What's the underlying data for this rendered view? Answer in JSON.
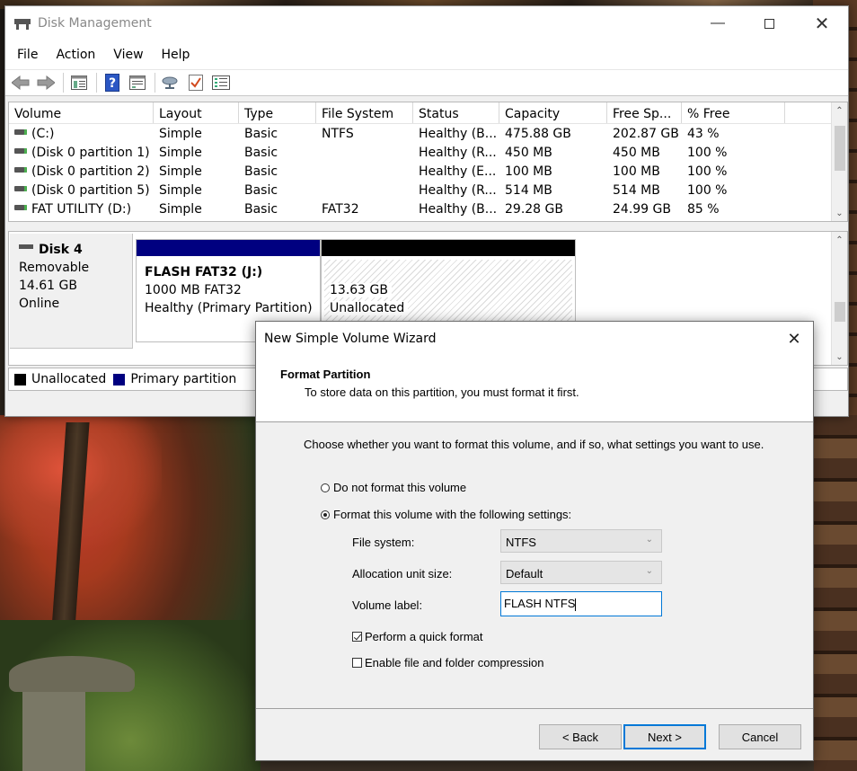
{
  "disk_management": {
    "title": "Disk Management",
    "menu": [
      "File",
      "Action",
      "View",
      "Help"
    ],
    "toolbar_icons": [
      "back-arrow-icon",
      "forward-arrow-icon",
      "console-tree-icon",
      "help-icon",
      "properties-icon",
      "connect-icon",
      "check-icon",
      "list-icon"
    ],
    "volume_table": {
      "columns": [
        "Volume",
        "Layout",
        "Type",
        "File System",
        "Status",
        "Capacity",
        "Free Sp...",
        "% Free"
      ],
      "rows": [
        [
          "(C:)",
          "Simple",
          "Basic",
          "NTFS",
          "Healthy (B...",
          "475.88 GB",
          "202.87 GB",
          "43 %"
        ],
        [
          "(Disk 0 partition 1)",
          "Simple",
          "Basic",
          "",
          "Healthy (R...",
          "450 MB",
          "450 MB",
          "100 %"
        ],
        [
          "(Disk 0 partition 2)",
          "Simple",
          "Basic",
          "",
          "Healthy (E...",
          "100 MB",
          "100 MB",
          "100 %"
        ],
        [
          "(Disk 0 partition 5)",
          "Simple",
          "Basic",
          "",
          "Healthy (R...",
          "514 MB",
          "514 MB",
          "100 %"
        ],
        [
          "FAT UTILITY (D:)",
          "Simple",
          "Basic",
          "FAT32",
          "Healthy (B...",
          "29.28 GB",
          "24.99 GB",
          "85 %"
        ]
      ]
    },
    "disk": {
      "name": "Disk 4",
      "kind": "Removable",
      "size": "14.61 GB",
      "state": "Online",
      "partitions": [
        {
          "name": "FLASH FAT32  (J:)",
          "detail": "1000 MB FAT32",
          "status": "Healthy (Primary Partition)"
        },
        {
          "name": "",
          "detail": "13.63 GB",
          "status": "Unallocated"
        }
      ]
    },
    "legend": [
      {
        "label": "Unallocated",
        "color": "#000000"
      },
      {
        "label": "Primary partition",
        "color": "#000080"
      }
    ]
  },
  "wizard": {
    "title": "New Simple Volume Wizard",
    "heading": "Format Partition",
    "subheading": "To store data on this partition, you must format it first.",
    "prompt": "Choose whether you want to format this volume, and if so, what settings you want to use.",
    "option_no_format": "Do not format this volume",
    "option_format": "Format this volume with the following settings:",
    "file_system_label": "File system:",
    "file_system_value": "NTFS",
    "allocation_label": "Allocation unit size:",
    "allocation_value": "Default",
    "volume_label_label": "Volume label:",
    "volume_label_value": "FLASH NTFS",
    "quick_format_label": "Perform a quick format",
    "compression_label": "Enable file and folder compression",
    "back_button": "< Back",
    "next_button": "Next >",
    "cancel_button": "Cancel"
  }
}
